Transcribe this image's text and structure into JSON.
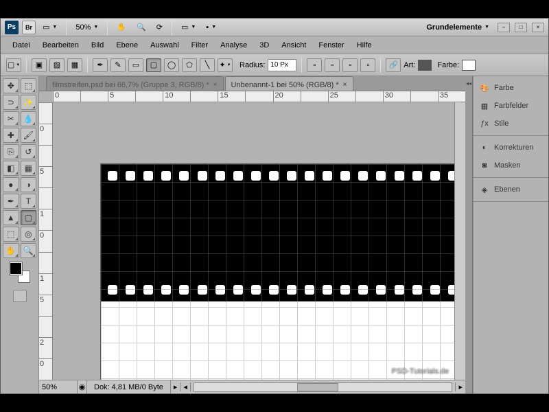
{
  "topbar": {
    "zoom_pct": "50%",
    "workspace": "Grundelemente"
  },
  "menu": [
    "Datei",
    "Bearbeiten",
    "Bild",
    "Ebene",
    "Auswahl",
    "Filter",
    "Analyse",
    "3D",
    "Ansicht",
    "Fenster",
    "Hilfe"
  ],
  "options": {
    "radius_label": "Radius:",
    "radius_value": "10 Px",
    "art_label": "Art:",
    "farbe_label": "Farbe:",
    "fill_color": "#ffffff",
    "art_color": "#555555"
  },
  "tabs": [
    {
      "label": "filmstreifen.psd bei 66,7% (Gruppe 3, RGB/8) *",
      "active": false
    },
    {
      "label": "Unbenannt-1 bei 50% (RGB/8) *",
      "active": true
    }
  ],
  "ruler_h": [
    "0",
    "",
    "5",
    "",
    "10",
    "",
    "15",
    "",
    "20",
    "",
    "25",
    "",
    "30",
    "",
    "35"
  ],
  "ruler_v": [
    "",
    "0",
    "",
    "5",
    "",
    "1",
    "0",
    "",
    "1",
    "5",
    "",
    "2",
    "0"
  ],
  "status": {
    "zoom": "50%",
    "doc": "Dok: 4,81 MB/0 Byte"
  },
  "panels": {
    "g1": [
      {
        "icon": "🎨",
        "label": "Farbe"
      },
      {
        "icon": "▦",
        "label": "Farbfelder"
      },
      {
        "icon": "ƒx",
        "label": "Stile"
      }
    ],
    "g2": [
      {
        "icon": "◐",
        "label": "Korrekturen"
      },
      {
        "icon": "◙",
        "label": "Masken"
      }
    ],
    "g3": [
      {
        "icon": "◈",
        "label": "Ebenen"
      }
    ]
  },
  "watermark": "PSD-Tutorials.de",
  "film": {
    "holes": 20
  }
}
